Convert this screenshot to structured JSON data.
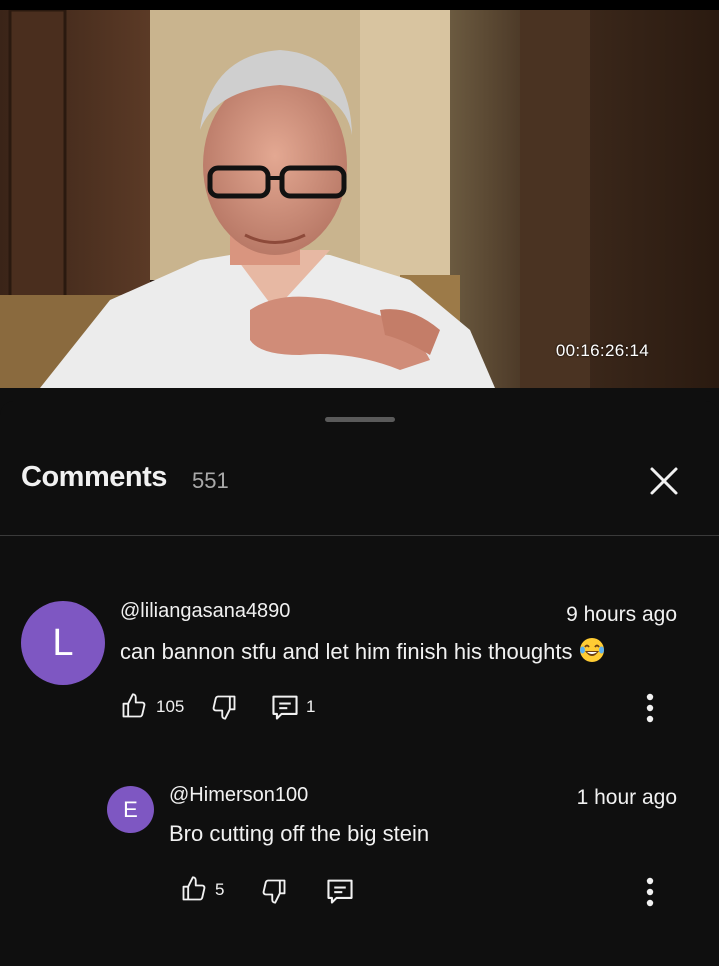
{
  "video": {
    "timestamp": "00:16:26:14"
  },
  "comments_panel": {
    "title": "Comments",
    "count": "551"
  },
  "comments": [
    {
      "avatar_letter": "L",
      "author": "@liliangasana4890",
      "time": "9 hours ago",
      "text": "can bannon stfu and let him finish his thoughts",
      "emoji": "face-with-tears-of-joy-icon",
      "likes": "105",
      "replies": "1"
    },
    {
      "avatar_letter": "E",
      "author": "@Himerson100",
      "time": "1 hour ago",
      "text": "Bro cutting off the big stein",
      "likes": "5"
    }
  ],
  "colors": {
    "background": "#0f0f0f",
    "avatar": "#7e57c2",
    "secondary_text": "#aaaaaa"
  }
}
